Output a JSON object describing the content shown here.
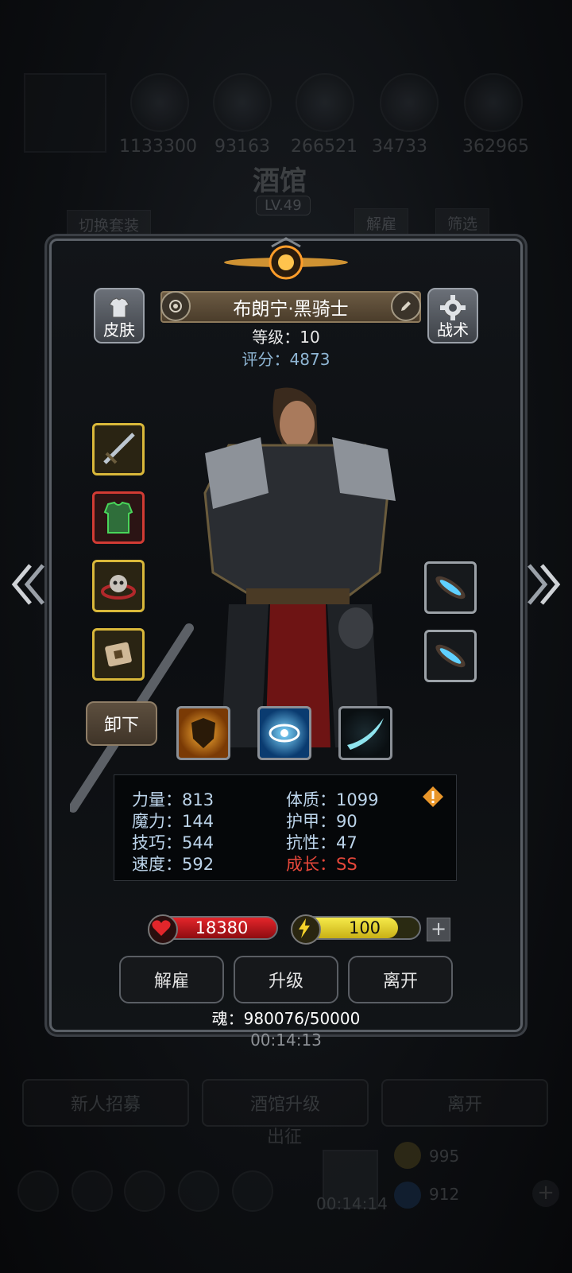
{
  "background": {
    "resources": [
      "1133300",
      "93163",
      "266521",
      "34733",
      "362965"
    ],
    "title": "酒馆",
    "level_badge": "LV.49",
    "switch_outfit": "切换套装",
    "dismiss_tab": "解雇",
    "filter_tab": "筛选",
    "timer": "00:14:13",
    "bottom_buttons": [
      "新人招募",
      "酒馆升级",
      "离开"
    ],
    "expedition": "出征",
    "dock_timer": "00:14:14",
    "gold_count": "995",
    "gem_count": "912"
  },
  "hero": {
    "name": "布朗宁·黑骑士",
    "level_label": "等级：10",
    "score_label": "评分：4873",
    "skin_label": "皮肤",
    "tactics_label": "战术",
    "unequip_label": "卸下"
  },
  "stats": {
    "strength": "力量：813",
    "magic": "魔力：144",
    "skill": "技巧：544",
    "speed": "速度：592",
    "constitution": "体质：1099",
    "armor": "护甲：90",
    "resistance": "抗性：47",
    "growth": "成长：SS"
  },
  "bars": {
    "hp": "18380",
    "energy": "100",
    "energy_fill": 0.83
  },
  "actions": {
    "dismiss": "解雇",
    "upgrade": "升级",
    "leave": "离开"
  },
  "soul_label": "魂：980076/50000",
  "colors": {
    "hp": "#c7161b",
    "energy": "#d9c81b",
    "growth": "#e6473a",
    "score": "#8fb6d4",
    "gold_border": "#d9b83a",
    "red_border": "#d13b34"
  }
}
